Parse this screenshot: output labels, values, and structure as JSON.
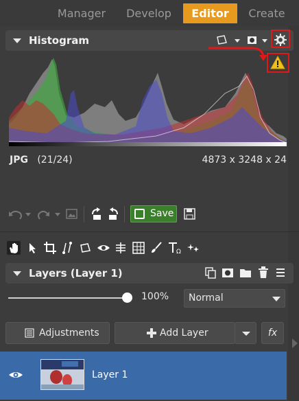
{
  "modes": {
    "manager": "Manager",
    "develop": "Develop",
    "editor": "Editor",
    "create": "Create"
  },
  "histogram": {
    "title": "Histogram",
    "format": "JPG",
    "index": "(21/24)",
    "dimensions": "4873 x 3248 x 24",
    "icons": [
      "selection-icon",
      "mask-icon",
      "settings-icon",
      "warning-icon"
    ]
  },
  "toolbar": {
    "save_label": "Save",
    "icons": [
      "undo-icon",
      "redo-icon",
      "image-icon",
      "rotate-left-icon",
      "rotate-right-icon",
      "save-icon",
      "save-as-icon"
    ]
  },
  "tools": [
    "hand-icon",
    "pointer-icon",
    "crop-icon",
    "straighten-icon",
    "selection-icon",
    "eye-icon",
    "level-icon",
    "grid-icon",
    "brush-icon",
    "text-icon",
    "effects-icon"
  ],
  "layers": {
    "title": "Layers (Layer 1)",
    "opacity": "100%",
    "opacity_value": 1.0,
    "blend_mode": "Normal",
    "adjustments_label": "Adjustments",
    "add_layer_label": "Add Layer",
    "fx_label": "fx",
    "items": [
      {
        "name": "Layer 1",
        "visible": true,
        "selected": true
      }
    ]
  },
  "colors": {
    "accent": "#e89a1f",
    "selected_layer": "#3a6aa8",
    "save_green": "#3a7f2a",
    "annotation_red": "#e01818"
  }
}
